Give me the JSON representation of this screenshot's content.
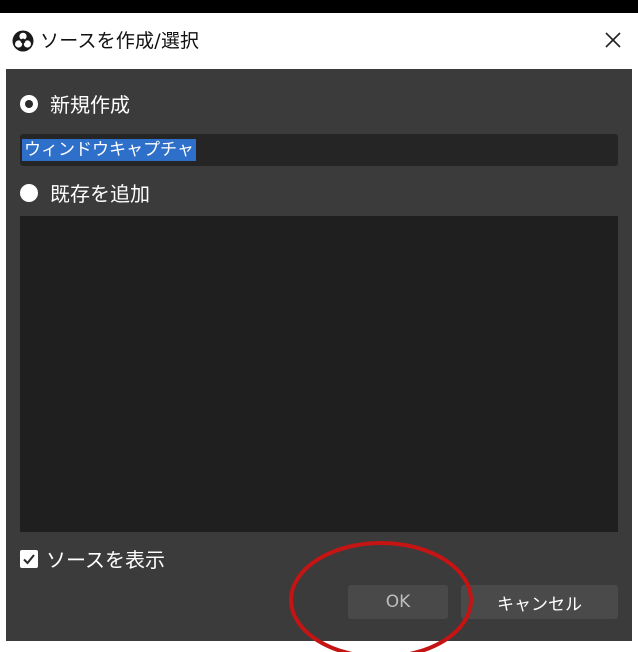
{
  "window": {
    "title": "ソースを作成/選択",
    "icon": "obs-logo-icon",
    "close_icon": "close-icon"
  },
  "options": {
    "create_new_label": "新規作成",
    "add_existing_label": "既存を追加",
    "selected": "create_new"
  },
  "name_input": {
    "value": "ウィンドウキャプチャ",
    "selected_text": true
  },
  "existing_sources": [],
  "visible_checkbox": {
    "label": "ソースを表示",
    "checked": true
  },
  "buttons": {
    "ok_label": "OK",
    "cancel_label": "キャンセル"
  },
  "colors": {
    "dialog_bg": "#3b3b3b",
    "input_bg": "#252525",
    "list_bg": "#1f1f1f",
    "selection": "#2e6fc9",
    "annotation": "#c41414"
  }
}
